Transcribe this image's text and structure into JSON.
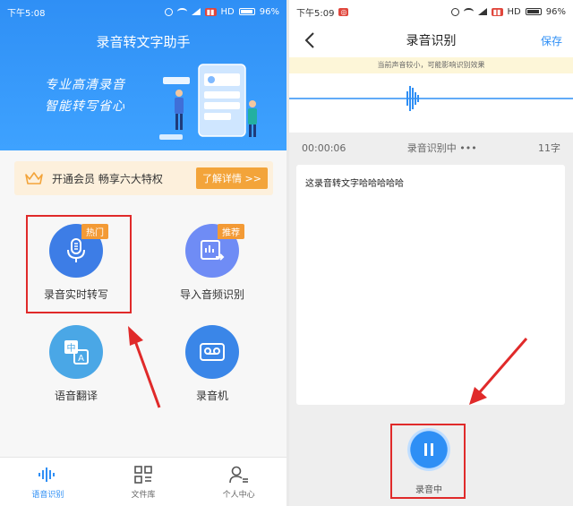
{
  "left": {
    "status": {
      "time": "下午5:08",
      "network": "HD",
      "battery": "96%"
    },
    "app_title": "录音转文字助手",
    "slogan_line1": "专业高清录音",
    "slogan_line2": "智能转写省心",
    "vip": {
      "text": "开通会员 畅享六大特权",
      "button": "了解详情 >>"
    },
    "features": [
      {
        "label": "录音实时转写",
        "tag": "热门"
      },
      {
        "label": "导入音频识别",
        "tag": "推荐"
      },
      {
        "label": "语音翻译",
        "tag": ""
      },
      {
        "label": "录音机",
        "tag": ""
      }
    ],
    "translate_glyphs": {
      "zh": "中",
      "en": "A"
    },
    "nav": [
      {
        "label": "语音识别",
        "active": true
      },
      {
        "label": "文件库",
        "active": false
      },
      {
        "label": "个人中心",
        "active": false
      }
    ]
  },
  "right": {
    "status": {
      "time": "下午5:09",
      "network": "HD",
      "battery": "96%"
    },
    "title": "录音识别",
    "save": "保存",
    "notice": "当前声音较小，可能影响识别效果",
    "elapsed": "00:00:06",
    "recognizing": "录音识别中",
    "char_count": "11字",
    "transcript": "这录音转文字哈哈哈哈哈",
    "record_label": "录音中"
  },
  "colors": {
    "primary": "#2f8ff5",
    "accent_orange": "#f3a43a",
    "highlight_red": "#e02a2a"
  }
}
